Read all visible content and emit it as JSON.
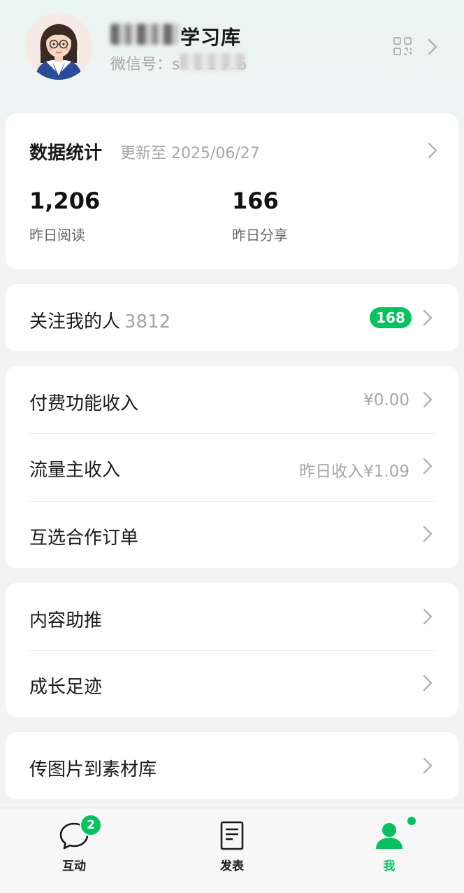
{
  "profile": {
    "name": "学习库",
    "wechat_id": "微信号：sh       ai2015"
  },
  "stats_card": {
    "title": "数据统计",
    "updated": "更新至 2025/06/27",
    "reads_value": "1,206",
    "reads_label": "昨日阅读",
    "shares_value": "166",
    "shares_label": "昨日分享"
  },
  "followers": {
    "label": "关注我的人",
    "count": "3812",
    "new_badge": "168"
  },
  "income": {
    "paid_label": "付费功能收入",
    "paid_value": "¥0.00",
    "traffic_label": "流量主收入",
    "traffic_value": "昨日收入¥1.09",
    "coop_label": "互选合作订单"
  },
  "growth": {
    "boost_label": "内容助推",
    "footprint_label": "成长足迹"
  },
  "material": {
    "upload_label": "传图片到素材库"
  },
  "tabbar": {
    "interact_label": "互动",
    "interact_badge": "2",
    "publish_label": "发表",
    "me_label": "我"
  },
  "colors": {
    "accent": "#07c160",
    "muted": "#a6a6a6",
    "background": "#f3f3f3"
  }
}
